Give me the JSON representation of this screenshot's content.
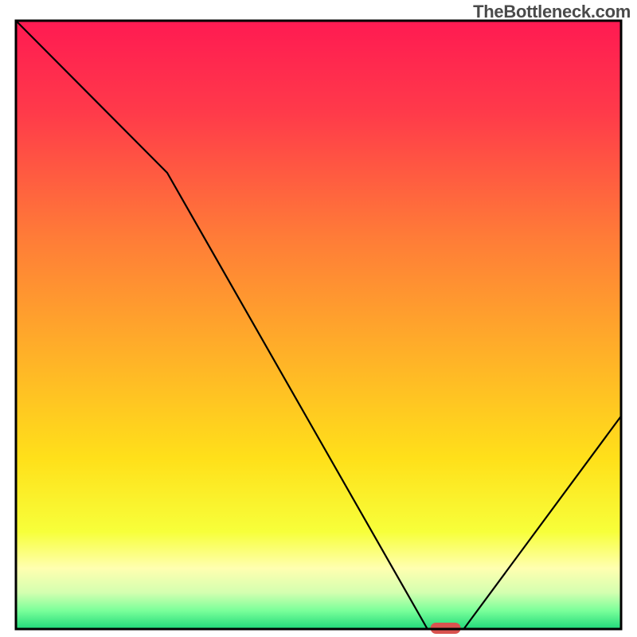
{
  "watermark": "TheBottleneck.com",
  "chart_data": {
    "type": "line",
    "title": "",
    "xlabel": "",
    "ylabel": "",
    "xlim": [
      0,
      100
    ],
    "ylim": [
      0,
      100
    ],
    "x": [
      0,
      25,
      68,
      74,
      100
    ],
    "values": [
      100,
      75,
      0,
      0,
      35
    ],
    "marker": {
      "x": 71,
      "y": 0,
      "color": "#d9534f",
      "shape": "rounded-rect"
    },
    "gradient_stops": [
      {
        "offset": 0.0,
        "color": "#ff1a52"
      },
      {
        "offset": 0.15,
        "color": "#ff3a4a"
      },
      {
        "offset": 0.35,
        "color": "#ff7a38"
      },
      {
        "offset": 0.55,
        "color": "#ffb128"
      },
      {
        "offset": 0.72,
        "color": "#ffe01a"
      },
      {
        "offset": 0.84,
        "color": "#f7ff3a"
      },
      {
        "offset": 0.9,
        "color": "#ffffb0"
      },
      {
        "offset": 0.94,
        "color": "#d4ffb0"
      },
      {
        "offset": 0.97,
        "color": "#7aff9a"
      },
      {
        "offset": 1.0,
        "color": "#1fd97a"
      }
    ],
    "frame_color": "#000000"
  }
}
